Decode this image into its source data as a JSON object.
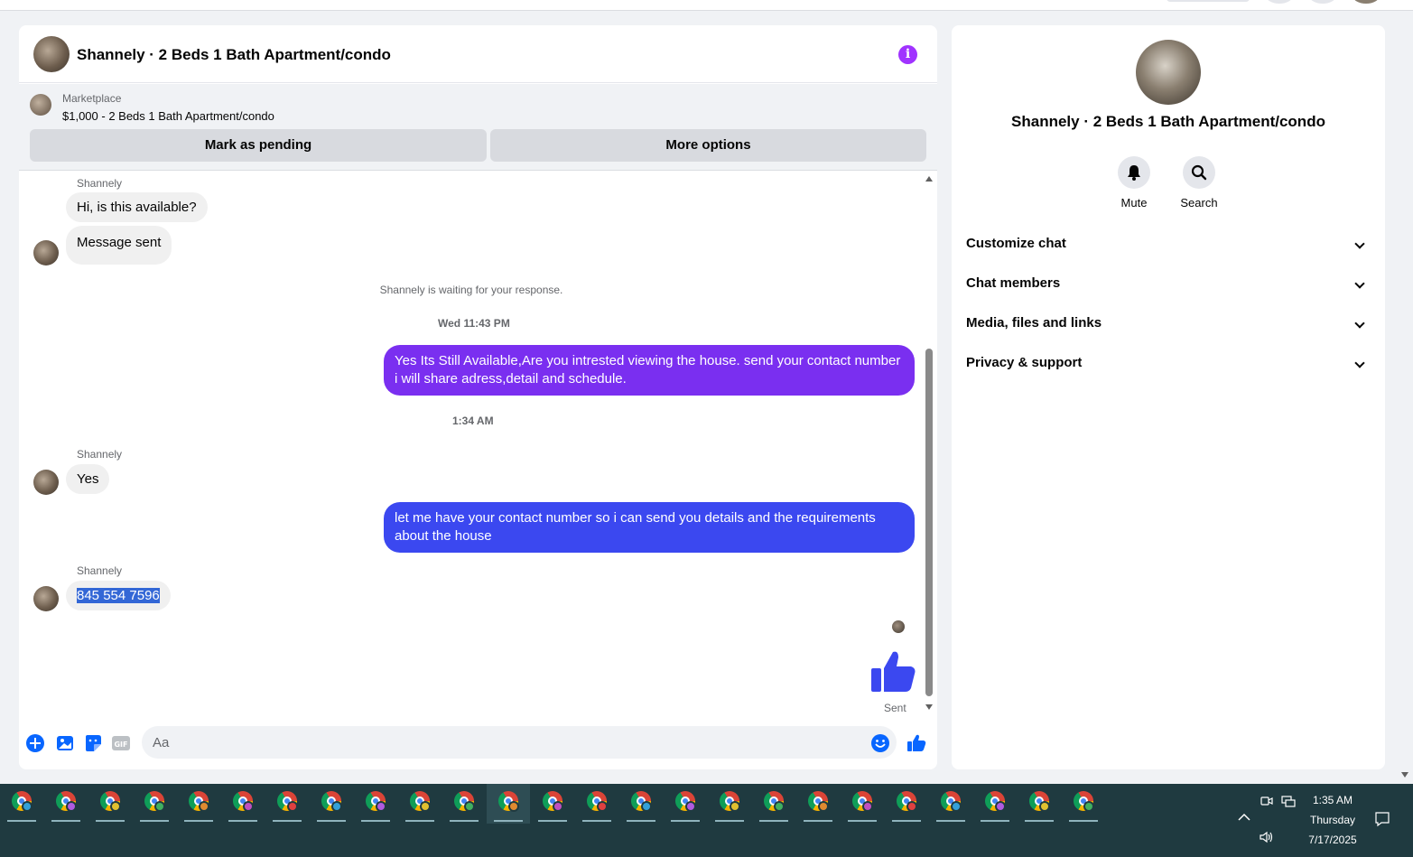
{
  "chat": {
    "title": "Shannely · 2 Beds 1 Bath Apartment/condo",
    "marketplace_label": "Marketplace",
    "listing": "$1,000 - 2 Beds 1 Bath Apartment/condo",
    "mark_pending_label": "Mark as pending",
    "more_options_label": "More options"
  },
  "messages": {
    "sender1": "Shannely",
    "msg1": "Hi, is this available?",
    "msg2": "Message sent",
    "waiting_notice": "Shannely is waiting for your response.",
    "timestamp1": "Wed 11:43 PM",
    "out1": "Yes Its Still Available,Are you intrested viewing the house. send your contact number i will share adress,detail and schedule.",
    "timestamp2": "1:34 AM",
    "sender2": "Shannely",
    "msg3": "Yes",
    "out2": "let me have your contact number so i can send you details and the requirements about the house",
    "sender3": "Shannely",
    "msg4": "845 554 7596",
    "sent_status": "Sent",
    "out1_color": "#7a2ff0",
    "out2_color": "#3b48f0"
  },
  "composer": {
    "placeholder": "Aa",
    "accent": "#0866ff"
  },
  "right_panel": {
    "title": "Shannely · 2 Beds 1 Bath Apartment/condo",
    "mute_label": "Mute",
    "search_label": "Search",
    "sections": [
      "Customize chat",
      "Chat members",
      "Media, files and links",
      "Privacy & support"
    ]
  },
  "taskbar": {
    "app_count": 25,
    "active_index": 11,
    "time": "1:35 AM",
    "day": "Thursday",
    "date": "7/17/2025"
  }
}
